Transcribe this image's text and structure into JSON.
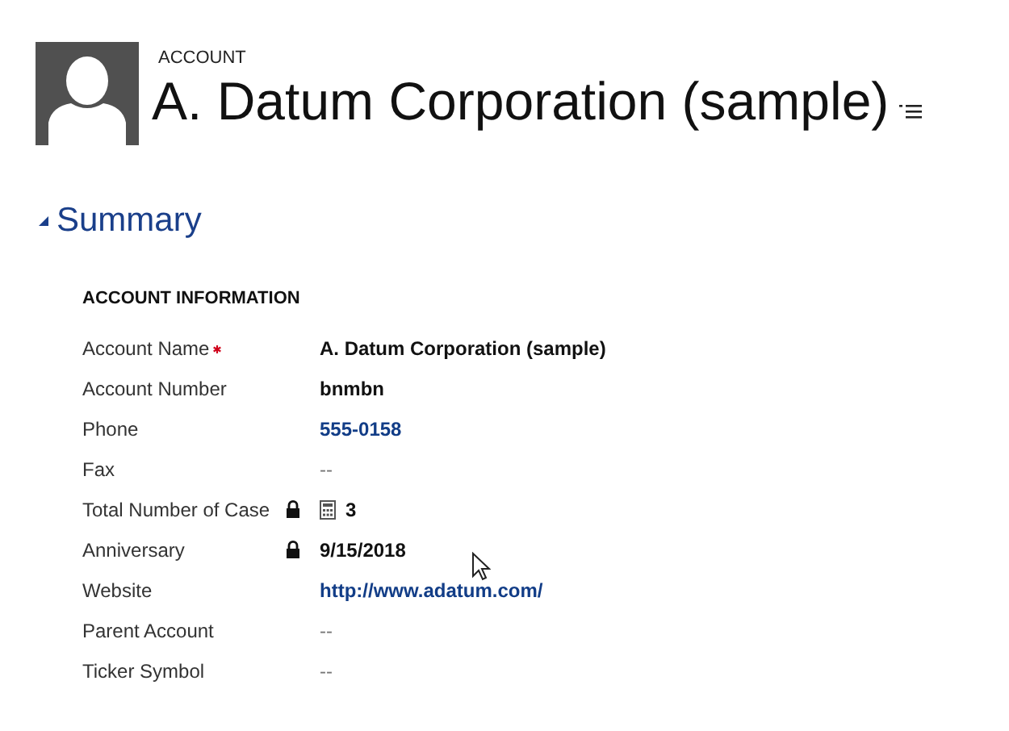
{
  "header": {
    "entity_type": "ACCOUNT",
    "title": "A. Datum Corporation (sample)"
  },
  "section": {
    "title": "Summary",
    "expanded": true
  },
  "group": {
    "title": "ACCOUNT INFORMATION"
  },
  "fields": [
    {
      "label": "Account Name",
      "required": true,
      "locked": false,
      "kind": "text",
      "value": "A. Datum Corporation (sample)"
    },
    {
      "label": "Account Number",
      "required": false,
      "locked": false,
      "kind": "text",
      "value": "bnmbn"
    },
    {
      "label": "Phone",
      "required": false,
      "locked": false,
      "kind": "link",
      "value": "555-0158"
    },
    {
      "label": "Fax",
      "required": false,
      "locked": false,
      "kind": "empty",
      "value": "--"
    },
    {
      "label": "Total Number of Case",
      "required": false,
      "locked": true,
      "kind": "rollup",
      "value": "3"
    },
    {
      "label": "Anniversary",
      "required": false,
      "locked": true,
      "kind": "text",
      "value": "9/15/2018"
    },
    {
      "label": "Website",
      "required": false,
      "locked": false,
      "kind": "link",
      "value": "http://www.adatum.com/"
    },
    {
      "label": "Parent Account",
      "required": false,
      "locked": false,
      "kind": "empty",
      "value": "--"
    },
    {
      "label": "Ticker Symbol",
      "required": false,
      "locked": false,
      "kind": "empty",
      "value": "--"
    }
  ]
}
